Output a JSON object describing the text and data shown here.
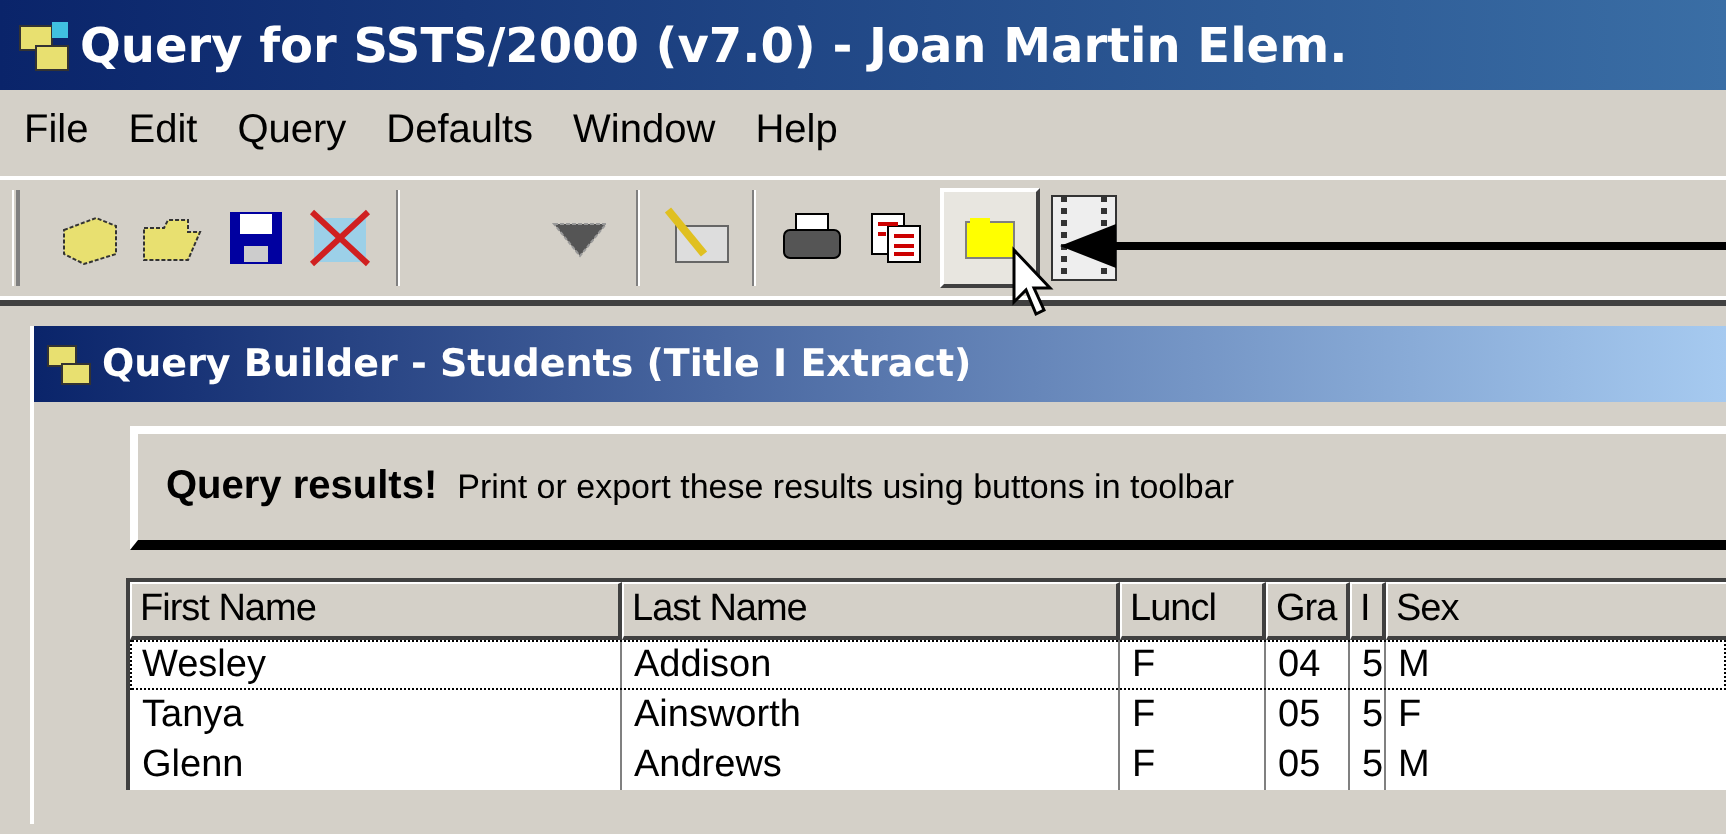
{
  "window": {
    "title": "Query for SSTS/2000 (v7.0) - Joan Martin Elem."
  },
  "menu": [
    "File",
    "Edit",
    "Query",
    "Defaults",
    "Window",
    "Help"
  ],
  "toolbar": [
    {
      "kind": "new",
      "pressed": false
    },
    {
      "kind": "open",
      "pressed": false
    },
    {
      "kind": "save",
      "pressed": false
    },
    {
      "kind": "delete",
      "pressed": false
    },
    {
      "kind": "separator"
    },
    {
      "kind": "gap"
    },
    {
      "kind": "run",
      "pressed": false
    },
    {
      "kind": "separator"
    },
    {
      "kind": "edit",
      "pressed": false
    },
    {
      "kind": "separator"
    },
    {
      "kind": "print",
      "pressed": false
    },
    {
      "kind": "columns",
      "pressed": false
    },
    {
      "kind": "export",
      "pressed": true
    },
    {
      "kind": "film",
      "pressed": false
    }
  ],
  "child": {
    "title": "Query Builder - Students (Title I Extract)",
    "banner": {
      "heading": "Query results!",
      "text": "Print or export these results using buttons in toolbar"
    },
    "table": {
      "columns": [
        "First Name",
        "Last Name",
        "Luncl",
        "Gra",
        "I",
        "Sex"
      ],
      "rows": [
        {
          "cells": [
            "Wesley",
            "Addison",
            "F",
            "04",
            "5",
            "M"
          ],
          "focused": true
        },
        {
          "cells": [
            "Tanya",
            "Ainsworth",
            "F",
            "05",
            "5",
            "F"
          ],
          "focused": false
        },
        {
          "cells": [
            "Glenn",
            "Andrews",
            "F",
            "05",
            "5",
            "M"
          ],
          "focused": false
        }
      ]
    }
  }
}
